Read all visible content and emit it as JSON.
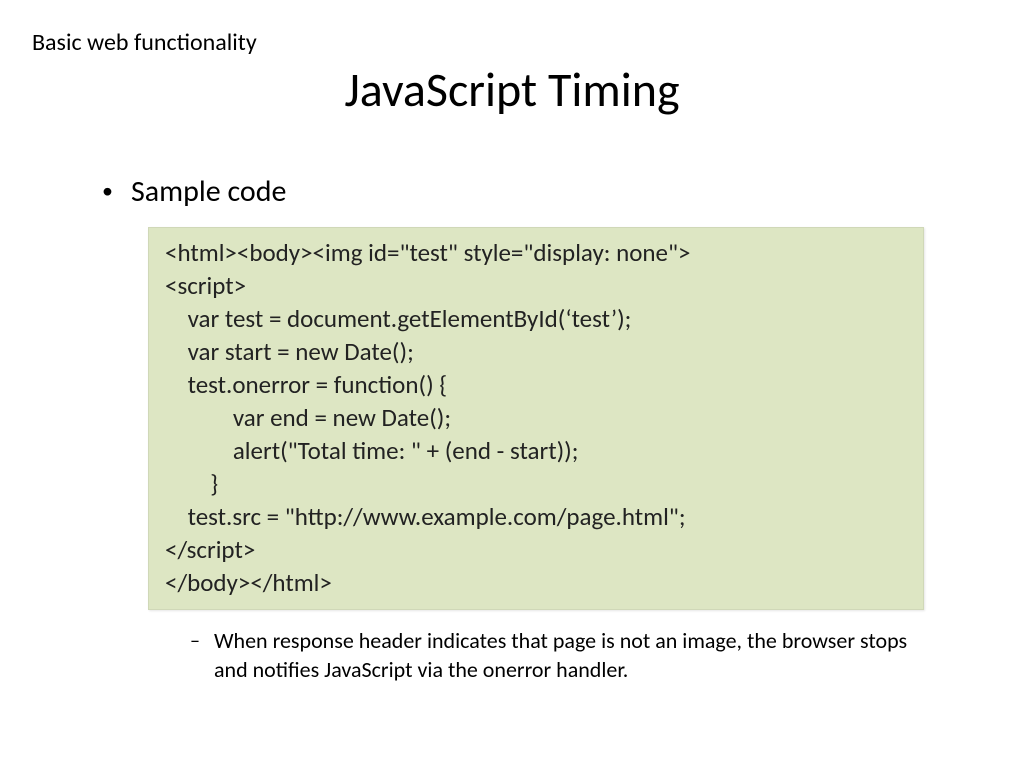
{
  "header": {
    "breadcrumb": "Basic web functionality",
    "title": "JavaScript Timing"
  },
  "body": {
    "bullet_label": "Sample code",
    "code": "<html><body><img id=\"test\" style=\"display: none\">\n<script>\n    var test = document.getElementById(‘test’);\n    var start = new Date();\n    test.onerror = function() {\n            var end = new Date();\n            alert(\"Total time: \" + (end - start));\n        }\n    test.src = \"http://www.example.com/page.html\";\n</script>\n</body></html>",
    "note": "When response header indicates that page is not an image, the browser stops and notifies JavaScript via the onerror handler."
  }
}
